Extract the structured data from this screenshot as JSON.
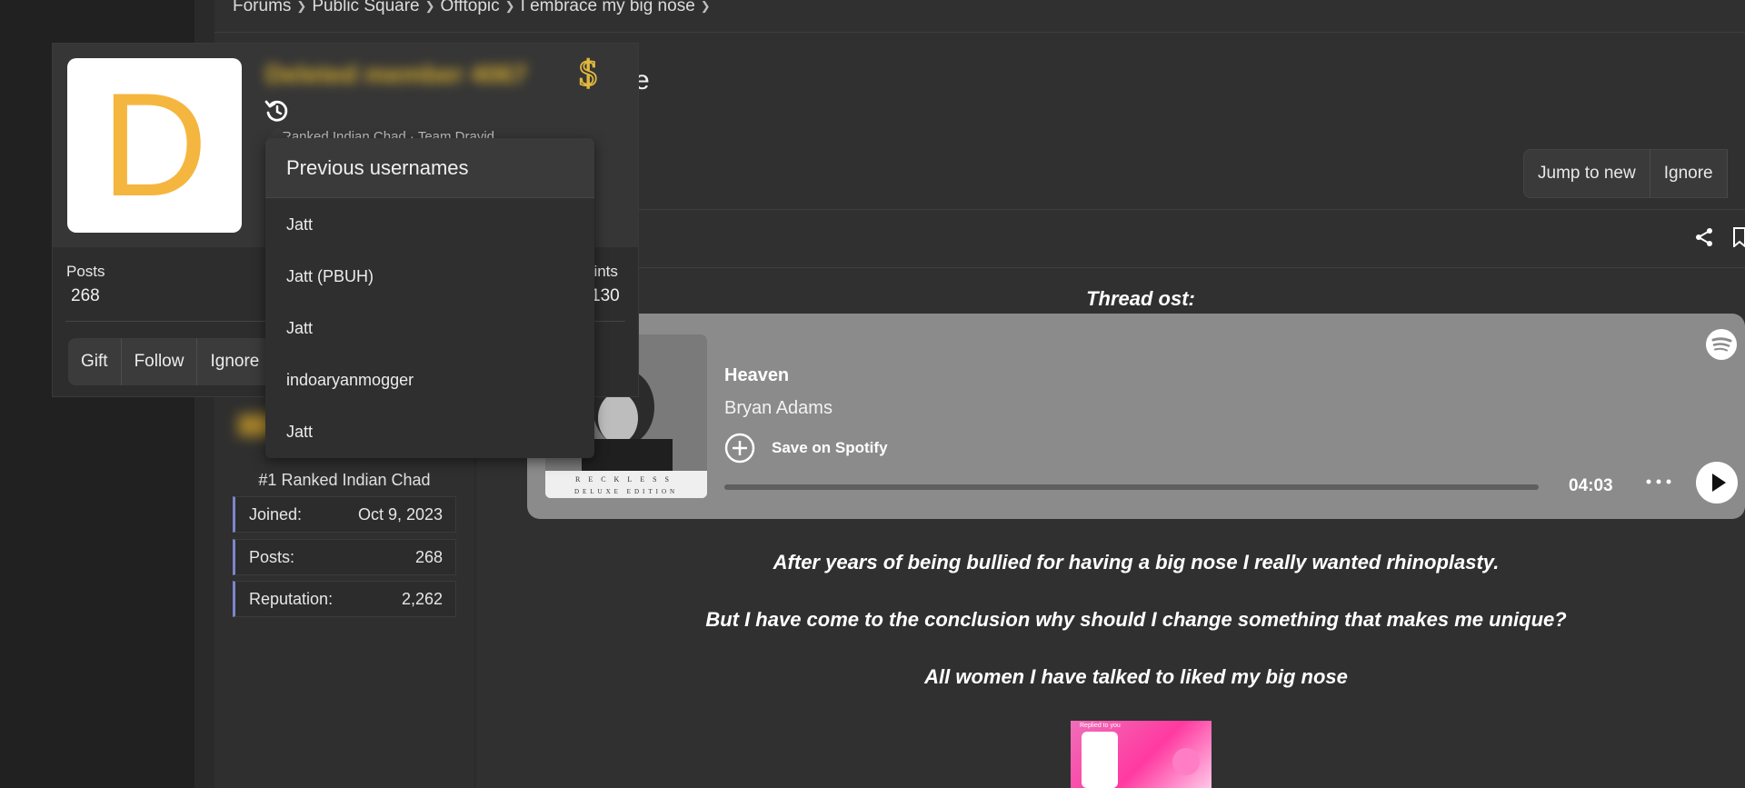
{
  "breadcrumb": [
    "Forums",
    "Public Square",
    "Offtopic",
    "I embrace my big nose"
  ],
  "thread": {
    "title_visible": "e"
  },
  "thread_buttons": {
    "jump_to_new": "Jump to new",
    "ignore": "Ignore"
  },
  "member_card": {
    "avatar_letter": "D",
    "username": "Deleted member 4067",
    "partial_text": "Ranked Indian Chad · Team Dravid",
    "posts_label": "Posts",
    "posts_value": "268",
    "points_label": "oints",
    "points_value": "130",
    "buttons": {
      "gift": "Gift",
      "follow": "Follow",
      "ignore": "Ignore"
    }
  },
  "previous_usernames": {
    "header": "Previous usernames",
    "items": [
      "Jatt",
      "Jatt (PBUH)",
      "Jatt",
      "indoaryanmogger",
      "Jatt"
    ]
  },
  "poster": {
    "rank": "#1 Ranked Indian Chad",
    "stats": [
      {
        "label": "Joined:",
        "value": "Oct 9, 2023"
      },
      {
        "label": "Posts:",
        "value": "268"
      },
      {
        "label": "Reputation:",
        "value": "2,262"
      }
    ]
  },
  "post": {
    "ost_label": "Thread ost:",
    "lines": [
      "After years of being bullied for having a big nose I really wanted rhinoplasty.",
      "But I have come to the conclusion why should I change something that makes me unique?",
      "All women I have talked to liked my big nose"
    ],
    "thumb_label": "Replied to you"
  },
  "spotify": {
    "track": "Heaven",
    "artist": "Bryan Adams",
    "save_label": "Save on Spotify",
    "duration": "04:03",
    "album_text": "RECKLESS",
    "album_edition": "DELUXE EDITION"
  }
}
